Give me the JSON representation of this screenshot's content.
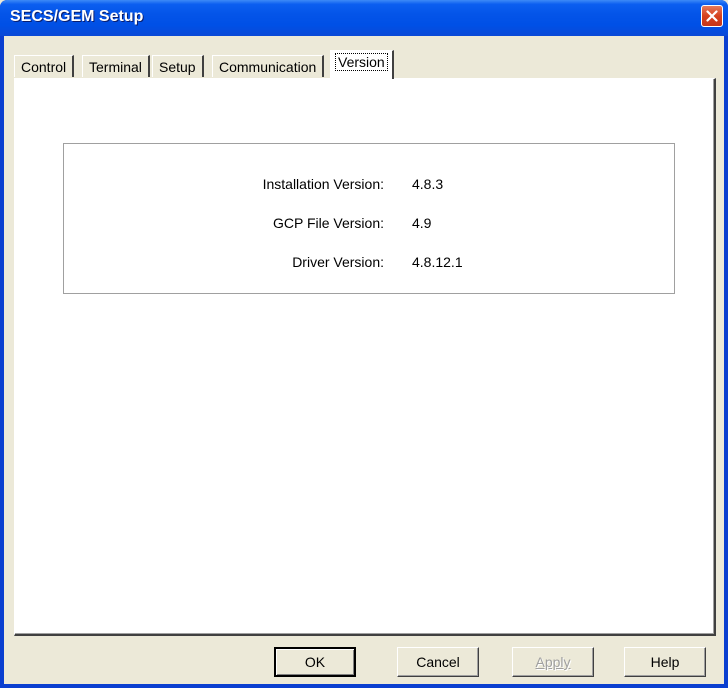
{
  "window": {
    "title": "SECS/GEM Setup"
  },
  "tabs": [
    {
      "label": "Control",
      "active": false
    },
    {
      "label": "Terminal",
      "active": false
    },
    {
      "label": "Setup",
      "active": false
    },
    {
      "label": "Communication",
      "active": false
    },
    {
      "label": "Version",
      "active": true
    }
  ],
  "version_info": {
    "installation": {
      "label": "Installation Version:",
      "value": "4.8.3"
    },
    "gcp_file": {
      "label": "GCP File Version:",
      "value": "4.9"
    },
    "driver": {
      "label": "Driver Version:",
      "value": "4.8.12.1"
    }
  },
  "buttons": {
    "ok": "OK",
    "cancel": "Cancel",
    "apply": "Apply",
    "help": "Help"
  },
  "icons": {
    "close": "close-icon"
  },
  "colors": {
    "titlebar": "#0054e3",
    "close_button": "#d6421e",
    "dialog_bg": "#ece9d8",
    "panel_bg": "#ffffff"
  }
}
